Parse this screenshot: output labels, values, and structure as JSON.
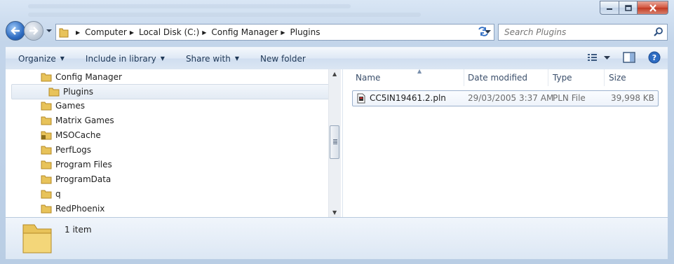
{
  "address": {
    "crumbs": [
      "Computer",
      "Local Disk (C:)",
      "Config Manager",
      "Plugins"
    ]
  },
  "search": {
    "placeholder": "Search Plugins"
  },
  "toolbar": {
    "organize": "Organize",
    "include_in_library": "Include in library",
    "share_with": "Share with",
    "new_folder": "New folder"
  },
  "tree": {
    "items": [
      {
        "label": "Config Manager"
      },
      {
        "label": "Plugins"
      },
      {
        "label": "Games"
      },
      {
        "label": "Matrix Games"
      },
      {
        "label": "MSOCache"
      },
      {
        "label": "PerfLogs"
      },
      {
        "label": "Program Files"
      },
      {
        "label": "ProgramData"
      },
      {
        "label": "q"
      },
      {
        "label": "RedPhoenix"
      }
    ]
  },
  "columns": {
    "name": "Name",
    "date_modified": "Date modified",
    "type": "Type",
    "size": "Size"
  },
  "files": [
    {
      "name": "CC5IN19461.2.pln",
      "date_modified": "29/03/2005 3:37 AM",
      "type": "PLN File",
      "size": "39,998 KB"
    }
  ],
  "details": {
    "item_count": "1 item"
  },
  "colors": {
    "folder": "#e8c35a",
    "accent": "#2e6cc2",
    "selection": "#e3ebf4"
  }
}
